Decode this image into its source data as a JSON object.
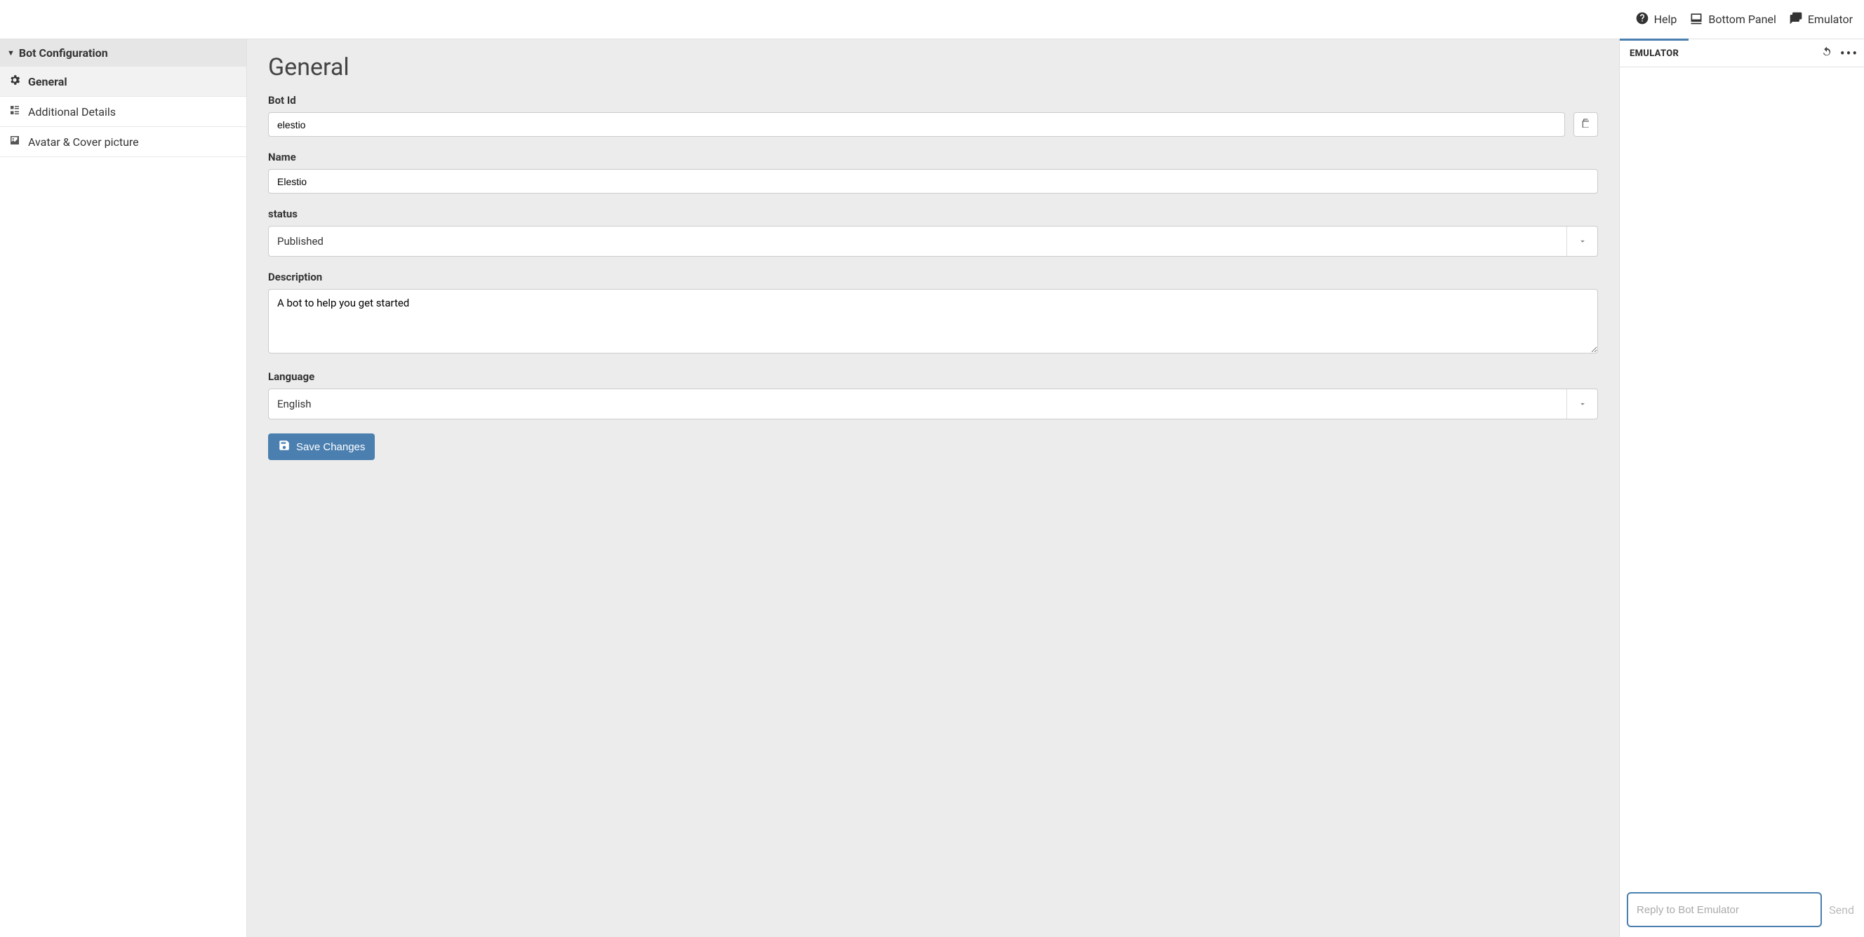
{
  "header": {
    "help": "Help",
    "bottom_panel": "Bottom Panel",
    "emulator": "Emulator"
  },
  "sidebar": {
    "section_title": "Bot Configuration",
    "items": [
      {
        "label": "General",
        "icon": "gear-icon",
        "active": true
      },
      {
        "label": "Additional Details",
        "icon": "details-icon",
        "active": false
      },
      {
        "label": "Avatar & Cover picture",
        "icon": "image-icon",
        "active": false
      }
    ]
  },
  "main": {
    "title": "General",
    "fields": {
      "bot_id": {
        "label": "Bot Id",
        "value": "elestio"
      },
      "name": {
        "label": "Name",
        "value": "Elestio"
      },
      "status": {
        "label": "status",
        "value": "Published"
      },
      "description": {
        "label": "Description",
        "value": "A bot to help you get started"
      },
      "language": {
        "label": "Language",
        "value": "English"
      }
    },
    "save_label": "Save Changes"
  },
  "emulator": {
    "tab_label": "EMULATOR",
    "input_placeholder": "Reply to Bot Emulator",
    "send_label": "Send"
  }
}
